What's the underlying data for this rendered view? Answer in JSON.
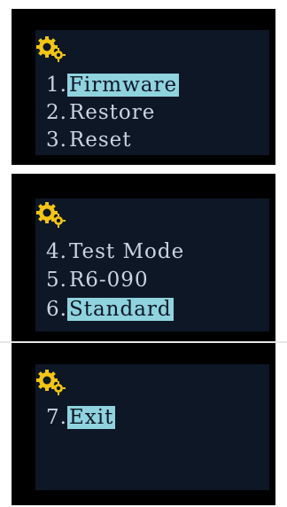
{
  "screens": [
    {
      "items": [
        {
          "number": "1.",
          "label": "Firmware",
          "selected": true
        },
        {
          "number": "2.",
          "label": "Restore",
          "selected": false
        },
        {
          "number": "3.",
          "label": "Reset",
          "selected": false
        }
      ]
    },
    {
      "items": [
        {
          "number": "4.",
          "label": "Test Mode",
          "selected": false
        },
        {
          "number": "5.",
          "label": "R6-090",
          "selected": false
        },
        {
          "number": "6.",
          "label": "Standard",
          "selected": true
        }
      ]
    },
    {
      "items": [
        {
          "number": "7.",
          "label": "Exit",
          "selected": true
        }
      ]
    }
  ],
  "icons": {
    "settings": "gear-icon"
  },
  "colors": {
    "panel": "#0e1726",
    "text": "#c9d4e3",
    "highlight": "#8fd3de",
    "gear": "#f3c515"
  }
}
